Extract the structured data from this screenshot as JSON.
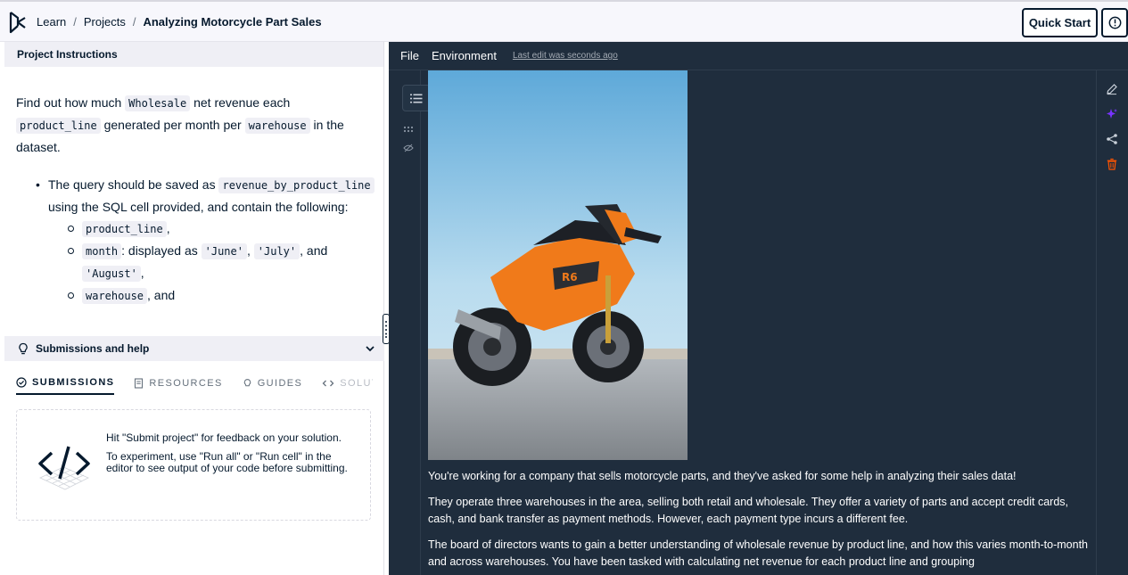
{
  "breadcrumb": {
    "items": [
      "Learn",
      "Projects"
    ],
    "current": "Analyzing Motorcycle Part Sales"
  },
  "header": {
    "quick_start_label": "Quick Start",
    "info_icon": "info-circle-icon"
  },
  "instructions": {
    "panel_title": "Project Instructions",
    "intro": {
      "t1": "Find out how much ",
      "c1": "Wholesale",
      "t2": " net revenue each ",
      "c2": "product_line",
      "t3": " generated per month per ",
      "c3": "warehouse",
      "t4": " in the dataset."
    },
    "bullet": {
      "t1": "The query should be saved as ",
      "c1": "revenue_by_product_line",
      "t2": " using the SQL cell provided, and contain the following:"
    },
    "sub_items": {
      "item1_code": "product_line",
      "item1_after": ",",
      "item2_code": "month",
      "item2_text": ": displayed as ",
      "item2_c1": "'June'",
      "item2_sep1": ", ",
      "item2_c2": "'July'",
      "item2_sep2": ", and ",
      "item2_c3": "'August'",
      "item2_after": ",",
      "item3_code": "warehouse",
      "item3_after": ", and"
    }
  },
  "submissions": {
    "title": "Submissions and help",
    "tabs": [
      "SUBMISSIONS",
      "RESOURCES",
      "GUIDES",
      "SOLUTIO"
    ],
    "message1": "Hit \"Submit project\" for feedback on your solution.",
    "message2": "To experiment, use \"Run all\" or \"Run cell\" in the editor to see output of your code before submitting."
  },
  "editor": {
    "menu": [
      "File",
      "Environment"
    ],
    "last_edit": "Last edit was seconds ago",
    "paragraphs": [
      "You're working for a company that sells motorcycle parts, and they've asked for some help in analyzing their sales data!",
      "They operate three warehouses in the area, selling both retail and wholesale. They offer a variety of parts and accept credit cards, cash, and bank transfer as payment methods. However, each payment type incurs a different fee.",
      "The board of directors wants to gain a better understanding of wholesale revenue by product line, and how this varies month-to-month and across warehouses. You have been tasked with calculating net revenue for each product line and grouping"
    ]
  },
  "colors": {
    "navy": "#05192d",
    "editor_bg": "#1f2d3d",
    "accent_purple": "#7933ff",
    "delete_orange": "#ff5400"
  }
}
